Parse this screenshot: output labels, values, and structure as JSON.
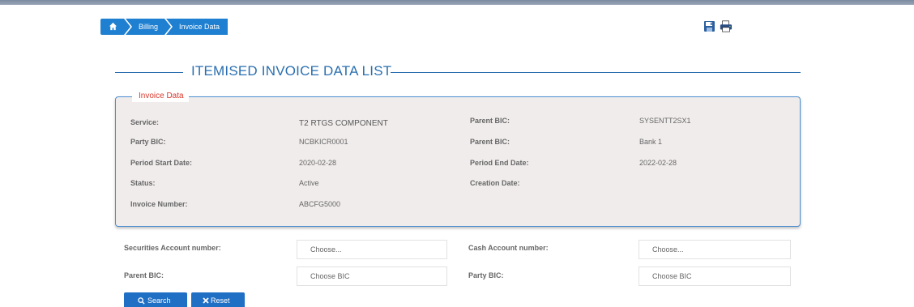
{
  "breadcrumb": {
    "home_icon": "home-icon",
    "items": [
      "Billing",
      "Invoice Data"
    ]
  },
  "toolbar": {
    "icons": [
      "save-icon",
      "print-icon"
    ]
  },
  "page": {
    "title": "ITEMISED INVOICE DATA LIST"
  },
  "invoice_data": {
    "legend": "Invoice Data",
    "left": [
      {
        "label": "Service:",
        "value": "T2 RTGS COMPONENT"
      },
      {
        "label": "Party BIC:",
        "value": "NCBKICR0001"
      },
      {
        "label": "Period Start Date:",
        "value": "2020-02-28"
      },
      {
        "label": "Status:",
        "value": "Active"
      },
      {
        "label": "Invoice Number:",
        "value": "ABCFG5000"
      }
    ],
    "right": [
      {
        "label": "Parent BIC:",
        "value": "SYSENTT2SX1"
      },
      {
        "label": "Parent BIC:",
        "value": "Bank 1"
      },
      {
        "label": "Period End Date:",
        "value": "2022-02-28"
      },
      {
        "label": "Creation Date:",
        "value": ""
      }
    ]
  },
  "filters": {
    "securities_account_label": "Securities Account number:",
    "securities_account_value": "Choose...",
    "cash_account_label": "Cash Account number:",
    "cash_account_value": "Choose...",
    "parent_bic_label": "Parent BIC:",
    "parent_bic_value": "Choose BIC",
    "party_bic_label": "Party BIC:",
    "party_bic_value": "Choose BIC"
  },
  "buttons": {
    "search": "Search",
    "reset": "Reset"
  },
  "colors": {
    "accent": "#1f7fd0",
    "title": "#2a6fb0",
    "legend": "#d9382c",
    "panel_bg": "#f1ecec"
  }
}
